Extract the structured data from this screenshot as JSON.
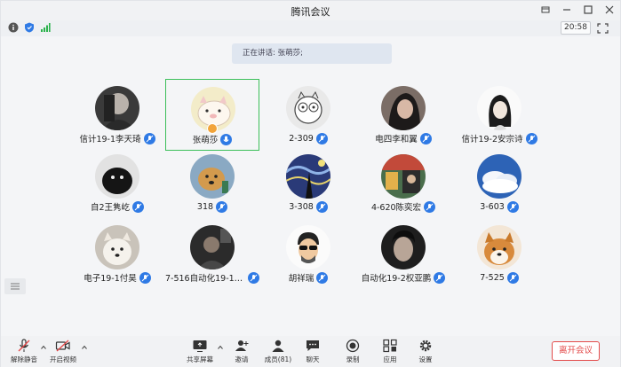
{
  "window": {
    "title": "腾讯会议"
  },
  "status": {
    "timer": "20:58"
  },
  "banner": {
    "text": "正在讲话: 张萌莎;"
  },
  "participants": [
    {
      "name": "信计19-1李天琦",
      "avatar": "dark-portrait"
    },
    {
      "name": "张萌莎",
      "avatar": "cartoon-pig",
      "active": true,
      "host": true
    },
    {
      "name": "2-309",
      "avatar": "cartoon-cat"
    },
    {
      "name": "电四李和翼",
      "avatar": "dark-hair-portrait"
    },
    {
      "name": "信计19-2安宗诗",
      "avatar": "sketch-girl"
    },
    {
      "name": "自2王隽屹",
      "avatar": "black-dog"
    },
    {
      "name": "318",
      "avatar": "golden-dog"
    },
    {
      "name": "3-308",
      "avatar": "starry-night"
    },
    {
      "name": "4-620陈奕宏",
      "avatar": "colorful-scene"
    },
    {
      "name": "3-603",
      "avatar": "sky-clouds"
    },
    {
      "name": "电子19-1付昊",
      "avatar": "white-dog"
    },
    {
      "name": "7-516自动化19-1刘...",
      "avatar": "dark-photo"
    },
    {
      "name": "胡祥瑞",
      "avatar": "sunglasses-man"
    },
    {
      "name": "自动化19-2权亚鹏",
      "avatar": "dark-face"
    },
    {
      "name": "7-525",
      "avatar": "shiba-dog"
    }
  ],
  "toolbar": {
    "unmute": "解除静音",
    "video": "开启视频",
    "share": "共享屏幕",
    "invite": "邀请",
    "members": "成员(81)",
    "chat": "聊天",
    "record": "录制",
    "apps": "应用",
    "settings": "设置",
    "leave": "离开会议"
  },
  "colors": {
    "accent": "#2f7ae5",
    "active_border": "#3cbf5a",
    "leave": "#e34a4a"
  }
}
